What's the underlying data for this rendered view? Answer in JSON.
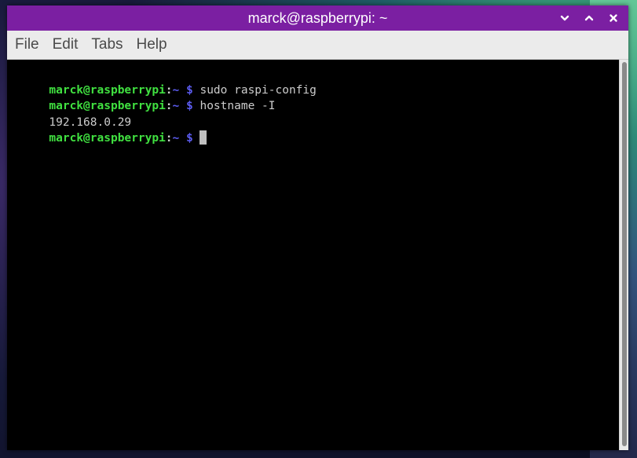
{
  "window": {
    "title": "marck@raspberrypi: ~",
    "titlebar_color": "#7b1fa2"
  },
  "window_controls": {
    "minimize_icon": "chevron-down-icon",
    "maximize_icon": "chevron-up-icon",
    "close_icon": "close-icon"
  },
  "menubar": {
    "items": [
      "File",
      "Edit",
      "Tabs",
      "Help"
    ]
  },
  "terminal": {
    "lines": [
      {
        "type": "prompt",
        "userhost": "marck@raspberrypi",
        "sep": ":",
        "path": "~",
        "dollar": " $ ",
        "command": "sudo raspi-config"
      },
      {
        "type": "prompt",
        "userhost": "marck@raspberrypi",
        "sep": ":",
        "path": "~",
        "dollar": " $ ",
        "command": "hostname -I"
      },
      {
        "type": "output",
        "text": "192.168.0.29"
      },
      {
        "type": "prompt",
        "userhost": "marck@raspberrypi",
        "sep": ":",
        "path": "~",
        "dollar": " $ ",
        "command": ""
      }
    ],
    "colors": {
      "userhost": "#40e040",
      "path": "#5c5cf0",
      "text": "#cccccc",
      "background": "#000000"
    }
  }
}
